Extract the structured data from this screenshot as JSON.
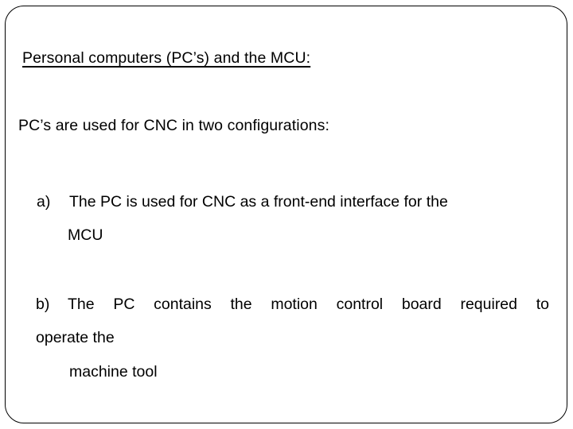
{
  "slide": {
    "background_color": "#ffffff",
    "text_color": "#000000",
    "border_color": "#000000",
    "heading": "Personal computers (PC’s) and the MCU:",
    "intro": "PC’s are used for CNC in two configurations:",
    "items": [
      {
        "marker": "a)",
        "line1": "The PC is used for CNC as a front-end interface for the",
        "line2": "MCU"
      },
      {
        "marker": "b)",
        "line1": "The PC contains the motion control board required to",
        "line2": "operate the",
        "line3": "machine tool"
      }
    ]
  }
}
